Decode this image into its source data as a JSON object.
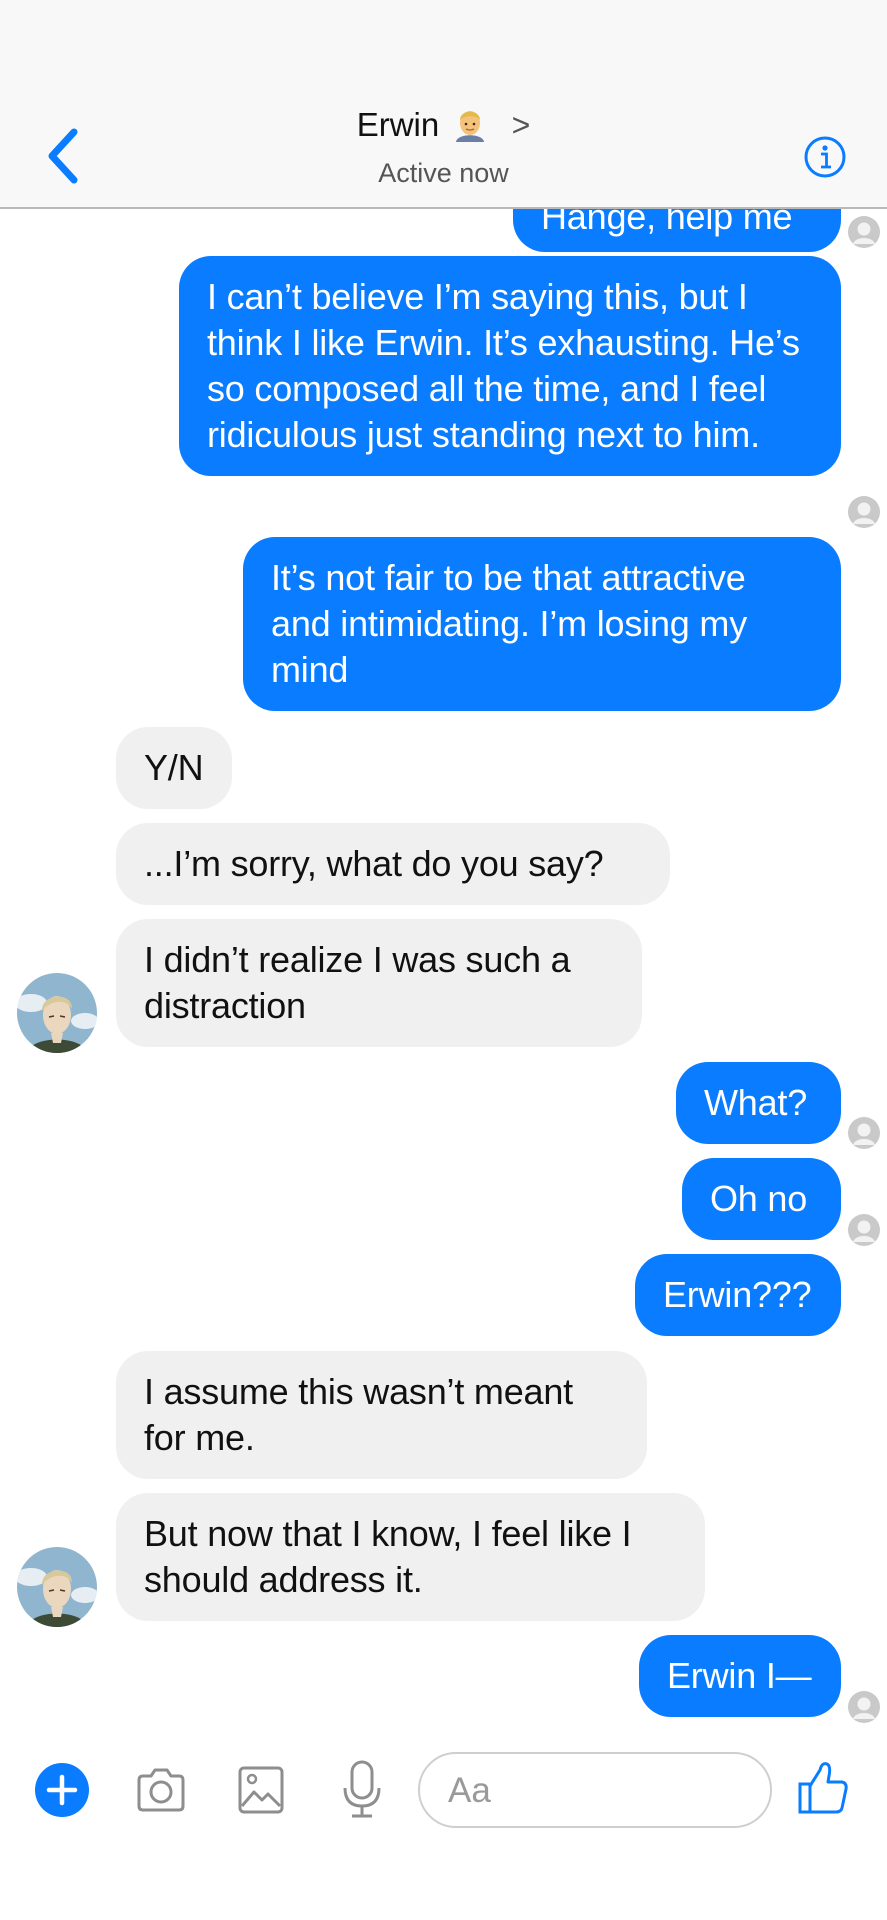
{
  "header": {
    "contact_name": "Erwin",
    "status": "Active now",
    "back_icon": "chevron-left-icon",
    "info_icon": "info-icon",
    "accent": "#0a7cff"
  },
  "messages": [
    {
      "from": "me",
      "text": "Hange, help me"
    },
    {
      "from": "me",
      "text": "I can’t believe I’m saying this, but I think I like Erwin. It’s exhausting. He’s so composed all the time, and I feel ridiculous just standing next to him."
    },
    {
      "from": "me",
      "text": "It’s not fair to be that attractive and intimidating. I’m losing my mind"
    },
    {
      "from": "them",
      "text": "Y/N"
    },
    {
      "from": "them",
      "text": "...I’m sorry, what do you say?"
    },
    {
      "from": "them",
      "text": "I didn’t realize I was such a distraction"
    },
    {
      "from": "me",
      "text": "What?"
    },
    {
      "from": "me",
      "text": "Oh no"
    },
    {
      "from": "me",
      "text": "Erwin???"
    },
    {
      "from": "them",
      "text": "I assume this wasn’t meant for me."
    },
    {
      "from": "them",
      "text": "But now that I know, I feel like I should address it."
    },
    {
      "from": "me",
      "text": "Erwin I—"
    }
  ],
  "composer": {
    "placeholder": "Aa",
    "icons": [
      "plus-icon",
      "camera-icon",
      "image-icon",
      "microphone-icon",
      "thumbs-up-icon"
    ]
  },
  "colors": {
    "outgoing_bubble": "#0a7cff",
    "incoming_bubble": "#f0f0f0"
  }
}
